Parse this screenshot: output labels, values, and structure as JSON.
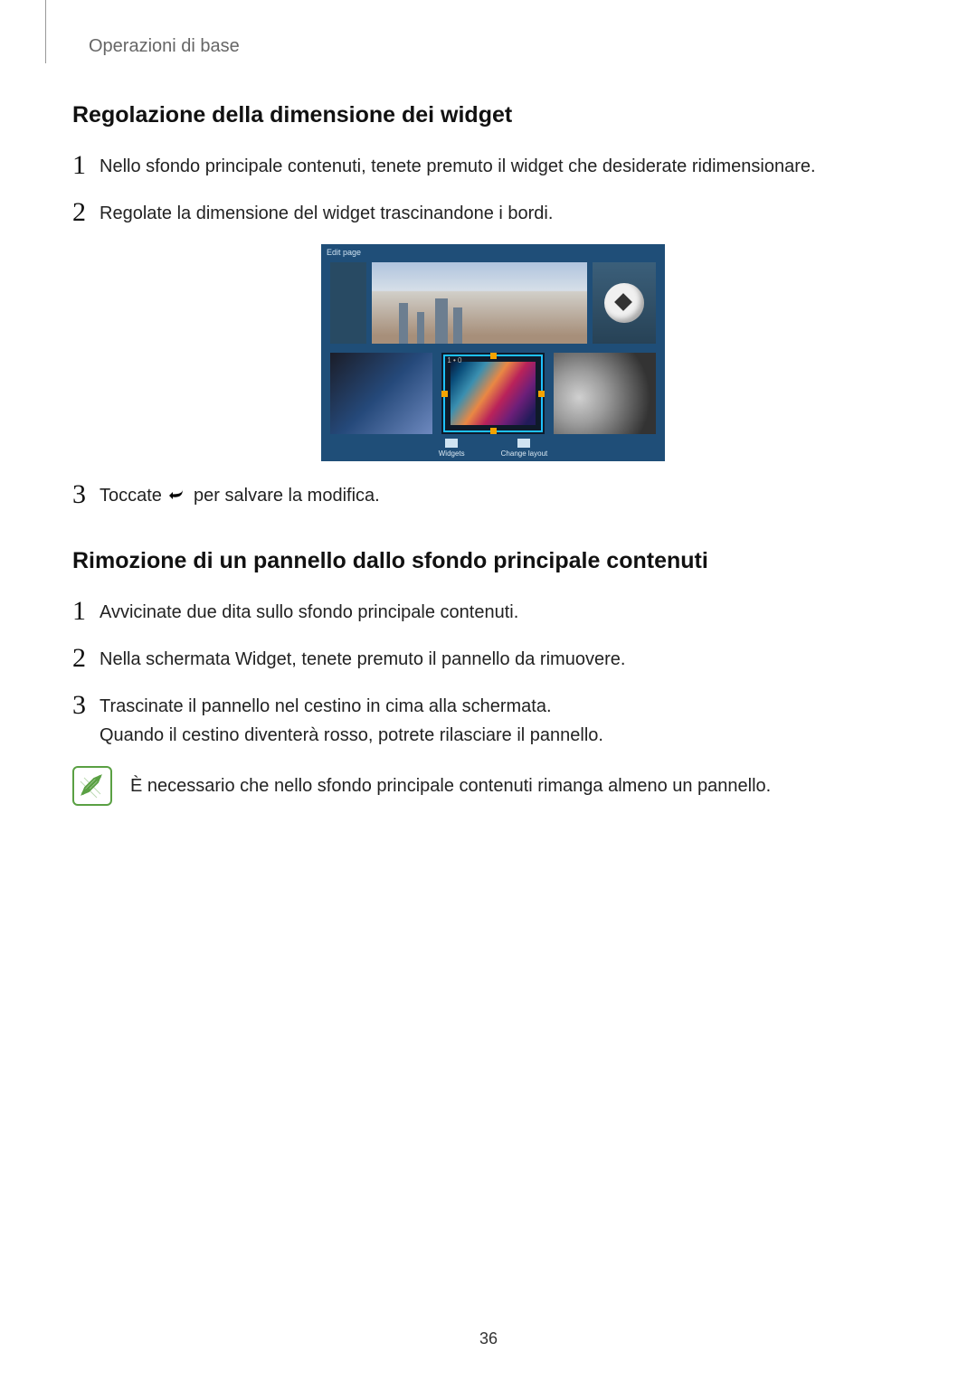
{
  "breadcrumb": "Operazioni di base",
  "heading1": "Regolazione della dimensione dei widget",
  "steps1": [
    {
      "num": "1",
      "text": "Nello sfondo principale contenuti, tenete premuto il widget che desiderate ridimensionare."
    },
    {
      "num": "2",
      "text": "Regolate la dimensione del widget trascinandone i bordi."
    },
    {
      "num": "3",
      "before": "Toccate ",
      "after": " per salvare la modifica."
    }
  ],
  "heading2": "Rimozione di un pannello dallo sfondo principale contenuti",
  "steps2": [
    {
      "num": "1",
      "text": "Avvicinate due dita sullo sfondo principale contenuti."
    },
    {
      "num": "2",
      "text": "Nella schermata Widget, tenete premuto il pannello da rimuovere."
    },
    {
      "num": "3",
      "text": "Trascinate il pannello nel cestino in cima alla schermata.",
      "text2": "Quando il cestino diventerà rosso, potrete rilasciare il pannello."
    }
  ],
  "note": "È necessario che nello sfondo principale contenuti rimanga almeno un pannello.",
  "figure_footer_labels": {
    "left": "Widgets",
    "right": "Change layout"
  },
  "page_number": "36"
}
